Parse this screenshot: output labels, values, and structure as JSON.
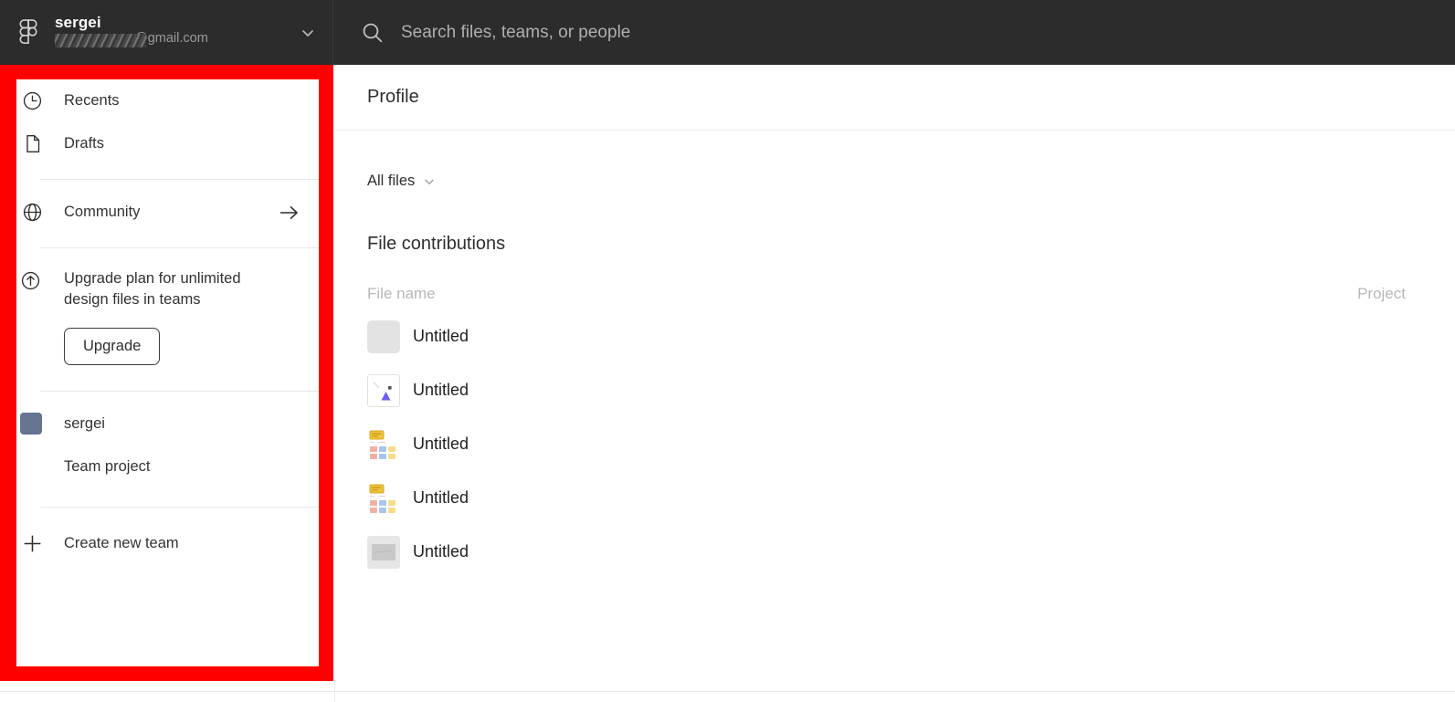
{
  "topbar": {
    "logo_icon": "figma-logo-icon",
    "account_name": "sergei",
    "account_email": "@gmail.com",
    "account_chevron_icon": "chevron-down-icon",
    "search_icon": "search-icon",
    "search_value": "",
    "search_placeholder": "Search files, teams, or people"
  },
  "sidebar": {
    "items": [
      {
        "label": "Recents",
        "icon": "clock-icon"
      },
      {
        "label": "Drafts",
        "icon": "file-icon"
      },
      {
        "label": "Community",
        "icon": "globe-icon",
        "trailing_icon": "arrow-right-icon"
      }
    ],
    "upgrade": {
      "icon": "arrow-up-circle-icon",
      "text": "Upgrade plan for unlimited design files in teams",
      "button_label": "Upgrade"
    },
    "team": {
      "name": "sergei",
      "avatar_color": "#667391",
      "project_label": "Team project"
    },
    "create_team": {
      "label": "Create new team",
      "icon": "plus-icon"
    }
  },
  "main": {
    "page_title": "Profile",
    "filter": {
      "label": "All files",
      "chevron_icon": "chevron-down-icon"
    },
    "section_title": "File contributions",
    "table": {
      "columns": {
        "file_name": "File name",
        "project": "Project"
      },
      "rows": [
        {
          "name": "Untitled",
          "thumb": "plain-gray",
          "project": ""
        },
        {
          "name": "Untitled",
          "thumb": "triangle",
          "project": ""
        },
        {
          "name": "Untitled",
          "thumb": "color-grid",
          "project": ""
        },
        {
          "name": "Untitled",
          "thumb": "color-grid",
          "project": ""
        },
        {
          "name": "Untitled",
          "thumb": "gray-image",
          "project": ""
        }
      ]
    }
  },
  "annotation": {
    "highlight_color": "#ff0000",
    "target": "sidebar"
  }
}
